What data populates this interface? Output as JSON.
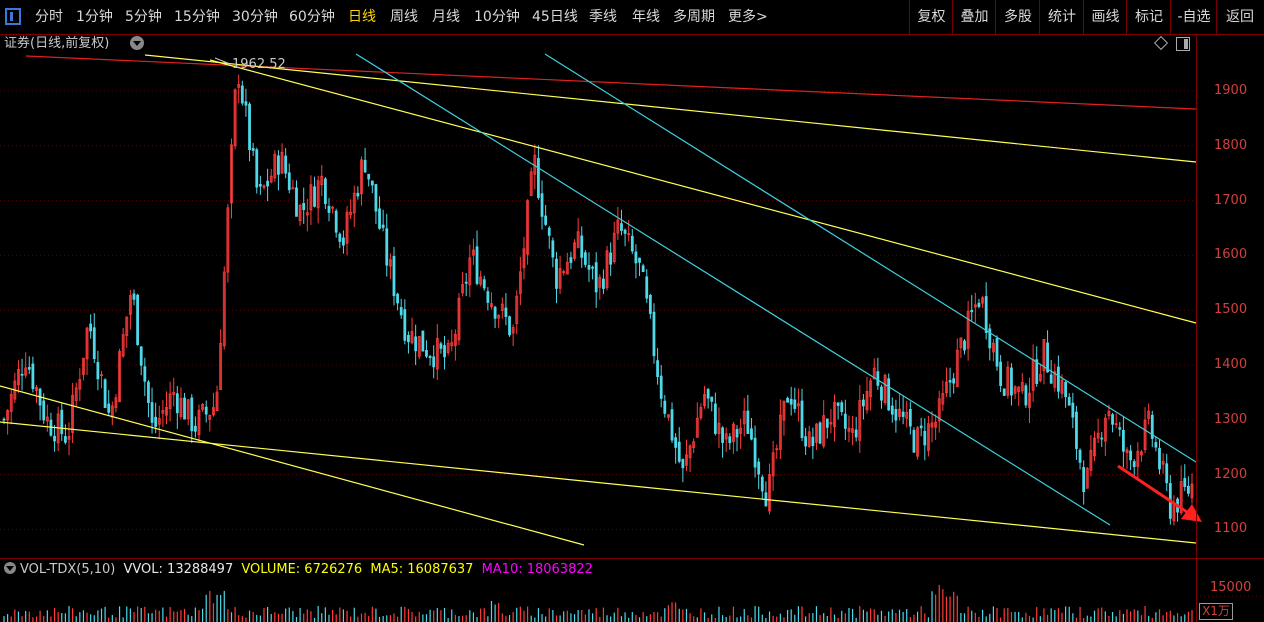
{
  "toolbar": {
    "periods": [
      "分时",
      "1分钟",
      "5分钟",
      "15分钟",
      "30分钟",
      "60分钟",
      "日线",
      "周线",
      "月线",
      "10分钟",
      "45日线",
      "季线",
      "年线",
      "多周期",
      "更多>"
    ],
    "active_period": "日线",
    "right_buttons": [
      "复权",
      "叠加",
      "多股",
      "统计",
      "画线",
      "标记",
      "-自选",
      "返回"
    ]
  },
  "chart_header": {
    "title": "证券(日线,前复权)"
  },
  "price_axis": {
    "ticks": [
      "1900",
      "1800",
      "1700",
      "1600",
      "1500",
      "1400",
      "1300",
      "1200",
      "1100"
    ]
  },
  "annotation": {
    "high_label": "1962.52"
  },
  "volume_header": {
    "indicator": "VOL-TDX(5,10)",
    "vvol": "VVOL: 13288497",
    "volume": "VOLUME: 6726276",
    "ma5": "MA5: 16087637",
    "ma10": "MA10: 18063822"
  },
  "volume_axis": {
    "tick": "15000",
    "unit": "X1万"
  },
  "colors": {
    "up": "#ff3b3b",
    "down": "#4fd8e8",
    "yellow": "#ffff55",
    "cyan": "#3fd0e0",
    "red_line": "#e02020",
    "grid": "#5a0000",
    "ma5": "#ffff00",
    "ma10": "#ff00ff"
  },
  "chart_data": {
    "type": "candlestick",
    "y_axis_ticks": [
      1100,
      1200,
      1300,
      1400,
      1500,
      1600,
      1700,
      1800,
      1900
    ],
    "highest_marked": 1962.52,
    "approx_close_path": [
      1300,
      1420,
      1300,
      1270,
      1480,
      1300,
      1540,
      1280,
      1350,
      1290,
      1330,
      1950,
      1700,
      1780,
      1680,
      1740,
      1630,
      1780,
      1600,
      1460,
      1430,
      1410,
      1600,
      1520,
      1460,
      1770,
      1560,
      1620,
      1540,
      1650,
      1570,
      1350,
      1200,
      1350,
      1250,
      1300,
      1160,
      1360,
      1250,
      1310,
      1270,
      1390,
      1320,
      1260,
      1300,
      1420,
      1530,
      1380,
      1340,
      1420,
      1350,
      1180,
      1330,
      1220,
      1290,
      1140,
      1180
    ]
  }
}
